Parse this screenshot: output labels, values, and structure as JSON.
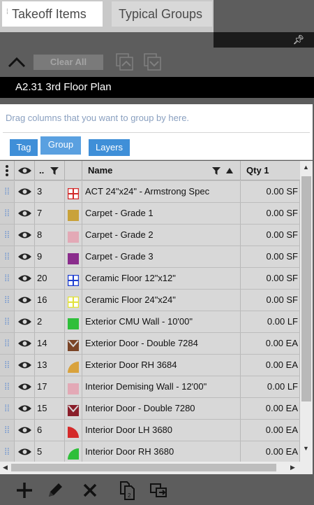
{
  "tabs": [
    {
      "label": "Takeoff Items",
      "active": true
    },
    {
      "label": "Typical Groups",
      "active": false
    }
  ],
  "toolbar": {
    "clear_all_label": "Clear All"
  },
  "plan": {
    "title": "A2.31 3rd Floor Plan"
  },
  "grouping": {
    "hint": "Drag columns that you want to group by here.",
    "chips": [
      "Tag",
      "Group",
      "Layers"
    ]
  },
  "grid": {
    "headers": {
      "id": "..",
      "name": "Name",
      "qty": "Qty 1"
    },
    "sort": {
      "column": "Name",
      "direction": "ascending"
    },
    "rows": [
      {
        "id": "3",
        "name": "ACT 24\"x24\" - Armstrong Spec",
        "qty": "0.00 SF",
        "swatch": "grid-red",
        "color": "#d22a2a"
      },
      {
        "id": "7",
        "name": "Carpet - Grade 1",
        "qty": "0.00 SF",
        "swatch": "solid",
        "color": "#c9a23a"
      },
      {
        "id": "8",
        "name": "Carpet - Grade 2",
        "qty": "0.00 SF",
        "swatch": "solid",
        "color": "#e3a9b6"
      },
      {
        "id": "9",
        "name": "Carpet - Grade 3",
        "qty": "0.00 SF",
        "swatch": "solid",
        "color": "#8a2c8c"
      },
      {
        "id": "20",
        "name": "Ceramic Floor 12\"x12\"",
        "qty": "0.00 SF",
        "swatch": "grid-blue",
        "color": "#1f3fd0"
      },
      {
        "id": "16",
        "name": "Ceramic Floor 24\"x24\"",
        "qty": "0.00 SF",
        "swatch": "grid-yellow",
        "color": "#e2e23a"
      },
      {
        "id": "2",
        "name": "Exterior CMU Wall - 10'00\"",
        "qty": "0.00 LF",
        "swatch": "solid",
        "color": "#2fbf3a"
      },
      {
        "id": "14",
        "name": "Exterior Door - Double 7284",
        "qty": "0.00 EA",
        "swatch": "double-door",
        "color": "#7a4426"
      },
      {
        "id": "13",
        "name": "Exterior Door RH 3684",
        "qty": "0.00 EA",
        "swatch": "door-rh",
        "color": "#d9a23c"
      },
      {
        "id": "17",
        "name": "Interior Demising Wall - 12'00\"",
        "qty": "0.00 LF",
        "swatch": "solid",
        "color": "#e3a9b6"
      },
      {
        "id": "15",
        "name": "Interior Door - Double 7280",
        "qty": "0.00 EA",
        "swatch": "double-door",
        "color": "#8a1e2a"
      },
      {
        "id": "6",
        "name": "Interior Door LH 3680",
        "qty": "0.00 EA",
        "swatch": "door-lh",
        "color": "#d42a2a"
      },
      {
        "id": "5",
        "name": "Interior Door RH 3680",
        "qty": "0.00 EA",
        "swatch": "door-rh",
        "color": "#2fbf3a"
      }
    ]
  },
  "icons": {
    "pin": "pin-icon",
    "collapse": "chevron-up-icon",
    "expand_all": "expand-all-icon",
    "collapse_all": "collapse-all-icon",
    "add": "plus-icon",
    "edit": "pencil-icon",
    "delete": "x-icon",
    "copy": "copy-pages-icon",
    "transfer": "transfer-icon"
  }
}
